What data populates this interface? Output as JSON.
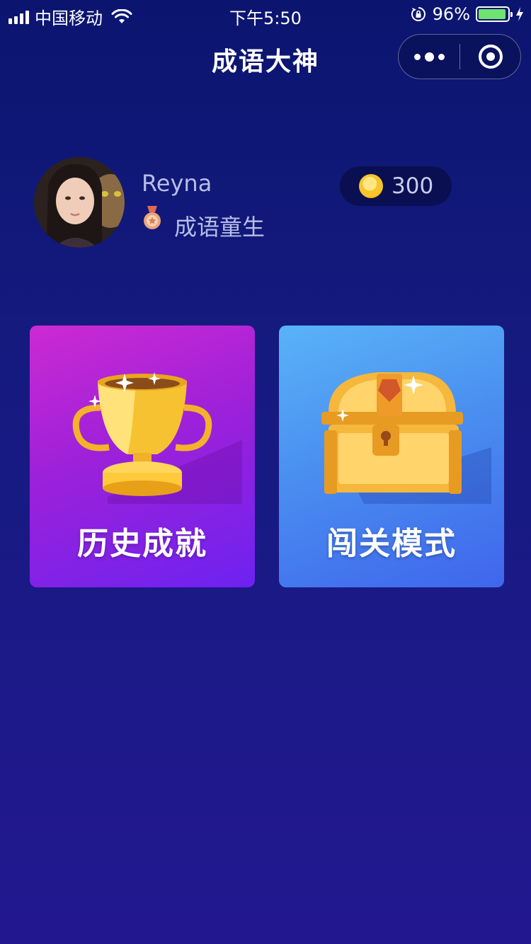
{
  "status_bar": {
    "carrier": "中国移动",
    "time": "下午5:50",
    "battery": "96%",
    "battery_level": 0.96
  },
  "nav": {
    "title": "成语大神"
  },
  "profile": {
    "name": "Reyna",
    "rank": "成语童生",
    "coins": "300"
  },
  "cards": [
    {
      "label": "历史成就",
      "icon": "trophy-icon"
    },
    {
      "label": "闯关模式",
      "icon": "treasure-chest-icon"
    }
  ],
  "colors": {
    "background": "#141a7e",
    "history_card": "#a822d8",
    "level_card": "#4a8ff0",
    "coin": "#f7c52b",
    "battery": "#6fe36f"
  }
}
